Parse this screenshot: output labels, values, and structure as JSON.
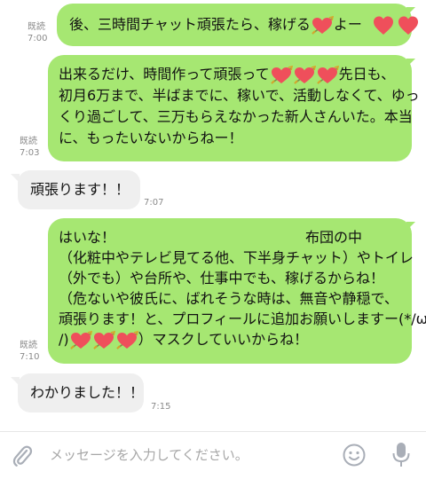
{
  "messages": [
    {
      "direction": "out",
      "read": "既読",
      "time": "7:00",
      "parts": [
        "後、三時間チャット頑張たら、稼げる",
        "よー"
      ]
    },
    {
      "direction": "out",
      "read": "既読",
      "time": "7:03",
      "line1a": "出来るだけ、時間作って頑張って",
      "line1b": "先日も、",
      "line2": "初月6万まで、半ばまでに、稼いで、活動しなくて、ゆっ",
      "line3": "くり過ごして、三万もらえなかった新人さんいた。本当",
      "line4": "に、もったいないからねー！"
    },
    {
      "direction": "in",
      "time": "7:07",
      "text": "頑張ります！！"
    },
    {
      "direction": "out",
      "read": "既読",
      "time": "7:10",
      "line1a": "はいな！",
      "line1b": "布団の中",
      "line2": "（化粧中やテレビ見てる他、下半身チャット）やトイレ",
      "line3": "（外でも）や台所や、仕事中でも、稼げるからね！",
      "line4": "（危ないや彼氏に、ばれそうな時は、無音や静穏で、",
      "line5": "頑張ります！と、プロフィールに追加お願いしますー(*/ω",
      "line6a": "/)",
      "line6b": "）マスクしていいからね！"
    },
    {
      "direction": "in",
      "time": "7:15",
      "text": "わかりました！！"
    }
  ],
  "input": {
    "placeholder": "メッセージを入力してください。"
  },
  "icons": {
    "attach": "paperclip-icon",
    "emoji": "smiley-icon",
    "voice": "microphone-icon",
    "heart": "heart-arrow-emoji"
  },
  "colors": {
    "outgoing_bubble": "#a6e772",
    "incoming_bubble": "#efefef",
    "heart": "#ef4f5b",
    "meta_text": "#8a8a8a",
    "placeholder": "#a7a7a7"
  }
}
